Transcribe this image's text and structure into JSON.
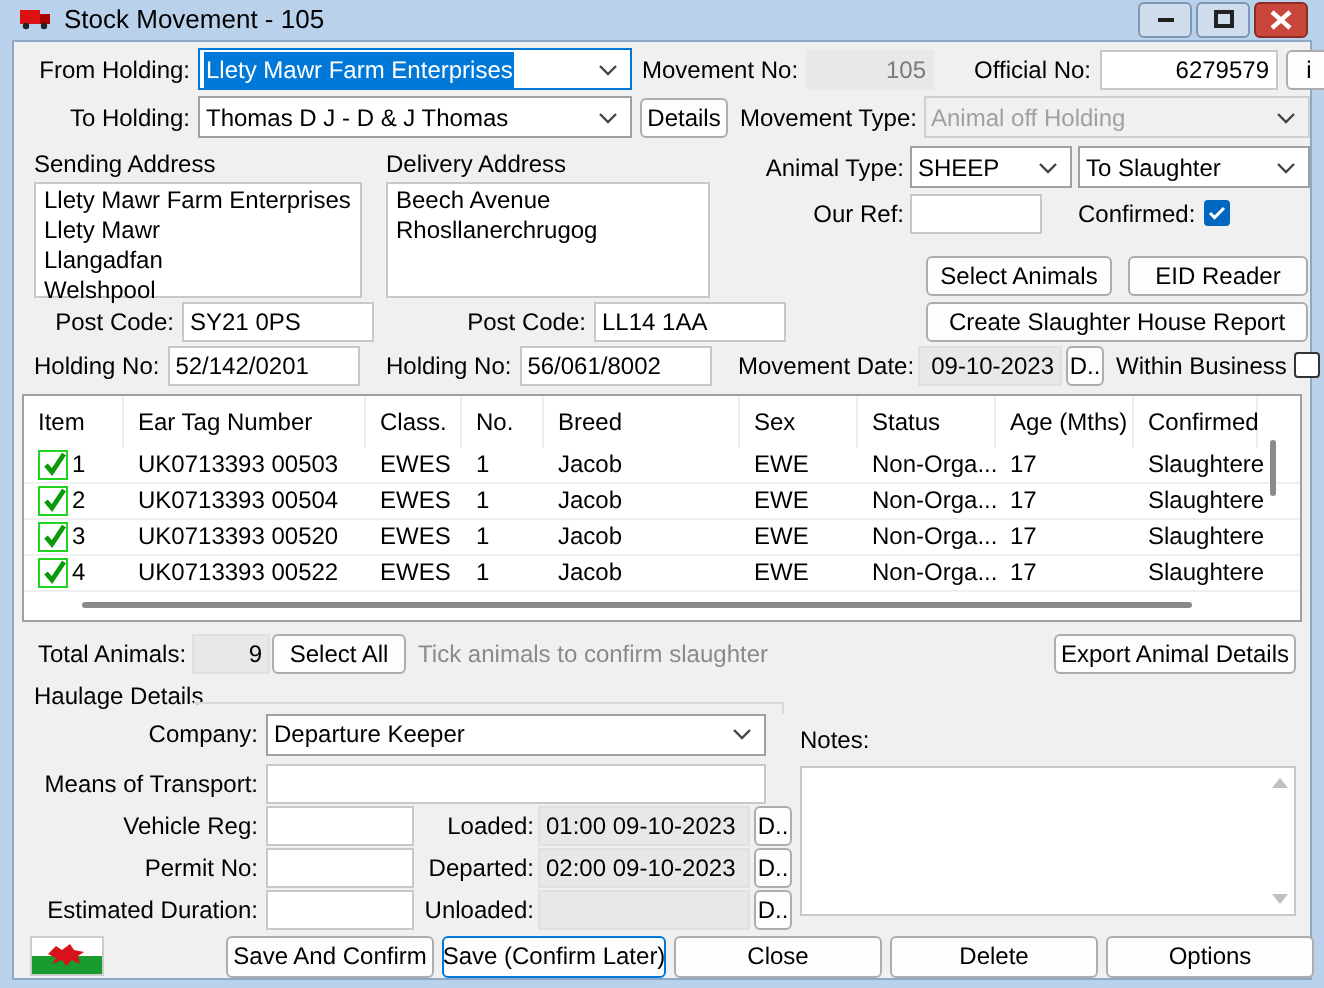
{
  "window": {
    "title": "Stock Movement - 105"
  },
  "from_holding": {
    "label": "From Holding:",
    "value": "Llety Mawr Farm Enterprises",
    "text_selected": true
  },
  "movement_no": {
    "label": "Movement No:",
    "value": "105",
    "disabled": true
  },
  "official_no": {
    "label": "Official No:",
    "value": "6279579"
  },
  "info_button": "i",
  "to_holding": {
    "label": "To Holding:",
    "value": "Thomas D J - D & J Thomas",
    "text_selected": false
  },
  "details_button": "Details",
  "movement_type": {
    "label": "Movement Type:",
    "value": "Animal off Holding",
    "disabled": true
  },
  "sending_address": {
    "label": "Sending Address",
    "lines": [
      "Llety Mawr Farm Enterprises",
      "Llety Mawr",
      "Llangadfan",
      "Welshpool"
    ],
    "post_code_label": "Post Code:",
    "post_code": "SY21 0PS",
    "holding_no_label": "Holding No:",
    "holding_no": "52/142/0201"
  },
  "delivery_address": {
    "label": "Delivery Address",
    "lines": [
      "Beech Avenue",
      "Rhosllanerchrugog"
    ],
    "post_code_label": "Post Code:",
    "post_code": "LL14 1AA",
    "holding_no_label": "Holding No:",
    "holding_no": "56/061/8002"
  },
  "animal_type": {
    "label": "Animal Type:",
    "value": "SHEEP",
    "purpose": "To Slaughter"
  },
  "our_ref": {
    "label": "Our Ref:"
  },
  "confirmed": {
    "label": "Confirmed:",
    "checked": true
  },
  "action_buttons": [
    "Select Animals",
    "EID Reader",
    "Create Slaughter House Report"
  ],
  "movement_date": {
    "label": "Movement Date:",
    "value": "09-10-2023",
    "picker": "D.."
  },
  "within_business": {
    "label": "Within Business",
    "checked": false
  },
  "table": {
    "columns": [
      "Item",
      "Ear Tag Number",
      "Class.",
      "No.",
      "Breed",
      "Sex",
      "Status",
      "Age (Mths)",
      "Confirmed"
    ],
    "rows": [
      {
        "checked": true,
        "cells": [
          "1",
          "UK0713393 00503",
          "EWES",
          "1",
          "Jacob",
          "EWE",
          "Non-Orga...",
          "17",
          "Slaughtere"
        ]
      },
      {
        "checked": true,
        "cells": [
          "2",
          "UK0713393 00504",
          "EWES",
          "1",
          "Jacob",
          "EWE",
          "Non-Orga...",
          "17",
          "Slaughtere"
        ]
      },
      {
        "checked": true,
        "cells": [
          "3",
          "UK0713393 00520",
          "EWES",
          "1",
          "Jacob",
          "EWE",
          "Non-Orga...",
          "17",
          "Slaughtere"
        ]
      },
      {
        "checked": true,
        "cells": [
          "4",
          "UK0713393 00522",
          "EWES",
          "1",
          "Jacob",
          "EWE",
          "Non-Orga...",
          "17",
          "Slaughtere"
        ]
      }
    ]
  },
  "total_animals": {
    "label": "Total Animals:",
    "value": "9"
  },
  "select_all_button": "Select All",
  "hint": "Tick animals to confirm slaughter",
  "export_button": "Export Animal Details",
  "haulage": {
    "title": "Haulage Details",
    "company": {
      "label": "Company:",
      "value": "Departure Keeper"
    },
    "means_label": "Means of Transport:",
    "fields": [
      {
        "label": "Vehicle Reg:"
      },
      {
        "label": "Permit No:"
      },
      {
        "label": "Estimated Duration:"
      }
    ],
    "times": [
      {
        "label": "Loaded:",
        "value": "01:00 09-10-2023",
        "picker": "D.."
      },
      {
        "label": "Departed:",
        "value": "02:00 09-10-2023",
        "picker": "D.."
      },
      {
        "label": "Unloaded:",
        "picker": "D.."
      }
    ]
  },
  "notes": {
    "label": "Notes:"
  },
  "footer_buttons": [
    {
      "label": "Save And Confirm",
      "focused": false
    },
    {
      "label": "Save (Confirm Later)",
      "focused": true
    },
    {
      "label": "Close",
      "focused": false
    },
    {
      "label": "Delete",
      "focused": false
    },
    {
      "label": "Options",
      "focused": false
    }
  ]
}
